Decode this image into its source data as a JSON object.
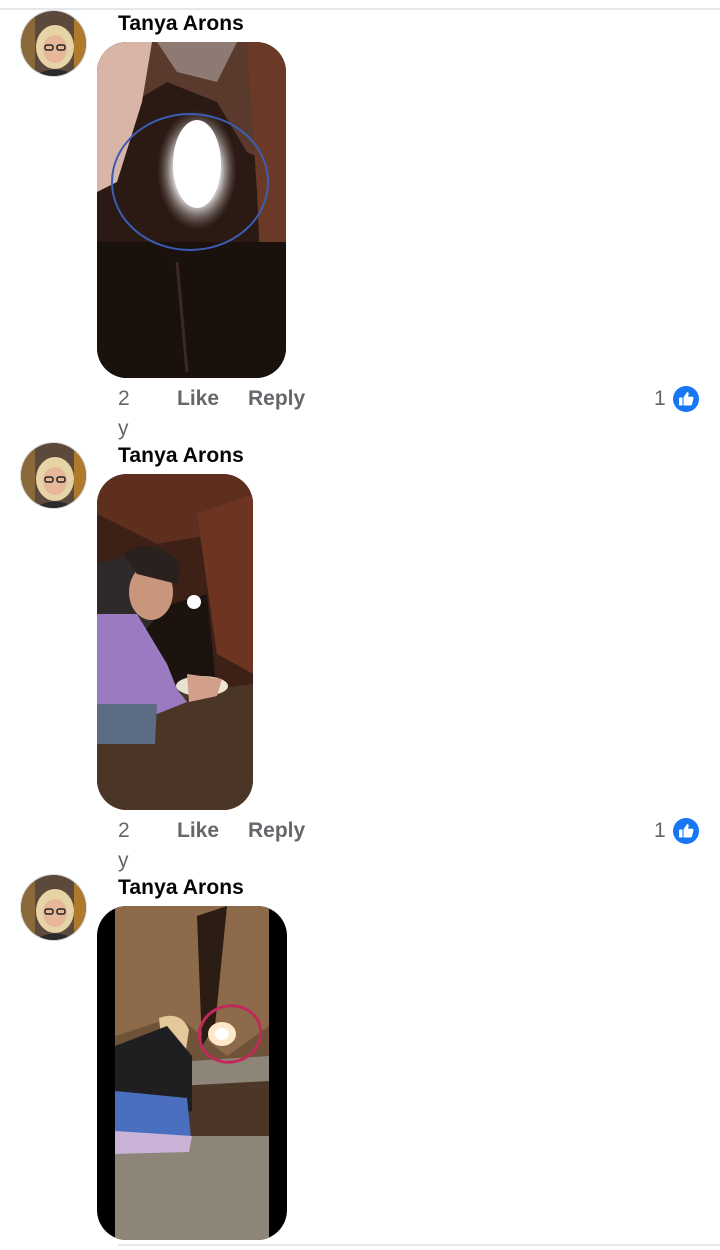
{
  "comments": [
    {
      "author": "Tanya Arons",
      "time": "2 y",
      "like_label": "Like",
      "reply_label": "Reply",
      "reaction_count": "1"
    },
    {
      "author": "Tanya Arons",
      "time": "2 y",
      "like_label": "Like",
      "reply_label": "Reply",
      "reaction_count": "1"
    },
    {
      "author": "Tanya Arons"
    }
  ],
  "colors": {
    "like_blue": "#1877f2",
    "secondary_text": "#65676b",
    "divider": "#e6e7ea"
  },
  "icons": {
    "reaction": "thumbs-up-like-icon"
  }
}
